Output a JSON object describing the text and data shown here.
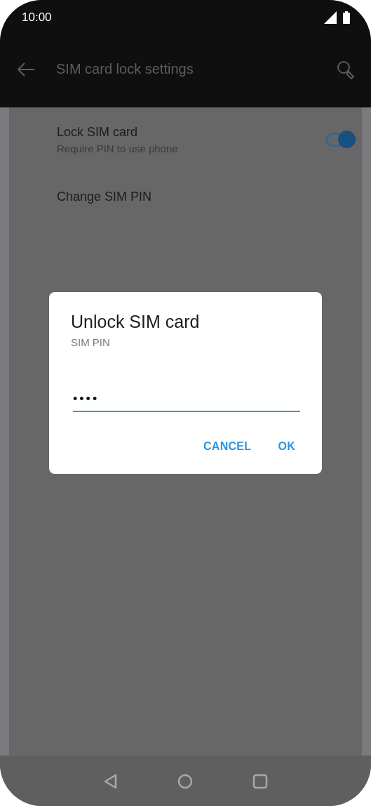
{
  "status_bar": {
    "time": "10:00"
  },
  "app_bar": {
    "title": "SIM card lock settings"
  },
  "settings": [
    {
      "kind": "toggle",
      "title": "Lock SIM card",
      "subtitle": "Require PIN to use phone",
      "on": true
    },
    {
      "kind": "plain",
      "title": "Change SIM PIN"
    }
  ],
  "dialog": {
    "title": "Unlock SIM card",
    "label": "SIM PIN",
    "value": "••••",
    "buttons": [
      "CANCEL",
      "OK"
    ]
  }
}
